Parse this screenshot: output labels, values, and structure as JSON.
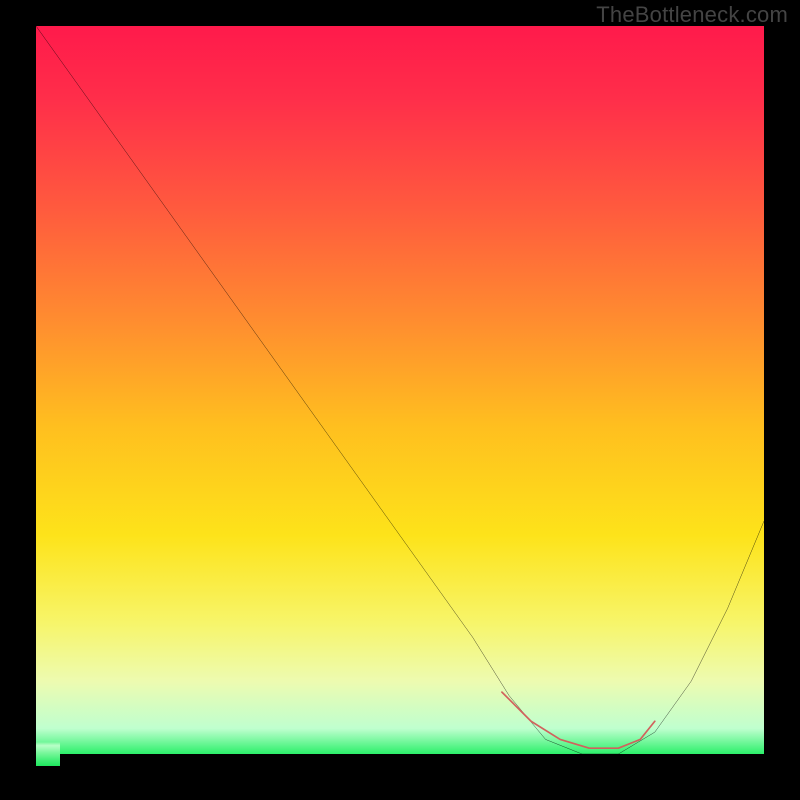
{
  "watermark": "TheBottleneck.com",
  "chart_data": {
    "type": "line",
    "title": "",
    "xlabel": "",
    "ylabel": "",
    "xlim": [
      0,
      100
    ],
    "ylim": [
      0,
      100
    ],
    "series": [
      {
        "name": "bottleneck-curve",
        "x": [
          0,
          10,
          20,
          30,
          40,
          50,
          60,
          65,
          70,
          75,
          80,
          85,
          90,
          95,
          100
        ],
        "values": [
          100,
          86,
          72,
          58,
          44,
          30,
          16,
          8,
          2,
          0,
          0,
          3,
          10,
          20,
          32
        ]
      }
    ],
    "highlight_segment": {
      "name": "optimal-range",
      "x": [
        64,
        68,
        72,
        76,
        80,
        83,
        85
      ],
      "values": [
        8.5,
        4.5,
        2,
        0.8,
        0.8,
        2,
        4.5
      ]
    },
    "gradient_stops": [
      {
        "pos": 0.0,
        "color": "#ff1a4b"
      },
      {
        "pos": 0.1,
        "color": "#ff2e4a"
      },
      {
        "pos": 0.25,
        "color": "#ff5a3e"
      },
      {
        "pos": 0.4,
        "color": "#ff8b30"
      },
      {
        "pos": 0.55,
        "color": "#ffbf1f"
      },
      {
        "pos": 0.7,
        "color": "#fde31a"
      },
      {
        "pos": 0.82,
        "color": "#f7f56a"
      },
      {
        "pos": 0.9,
        "color": "#edfbb0"
      },
      {
        "pos": 0.965,
        "color": "#bfffcf"
      },
      {
        "pos": 1.0,
        "color": "#2cf06a"
      }
    ],
    "highlight_color": "#d1625d",
    "curve_color": "#000000"
  }
}
